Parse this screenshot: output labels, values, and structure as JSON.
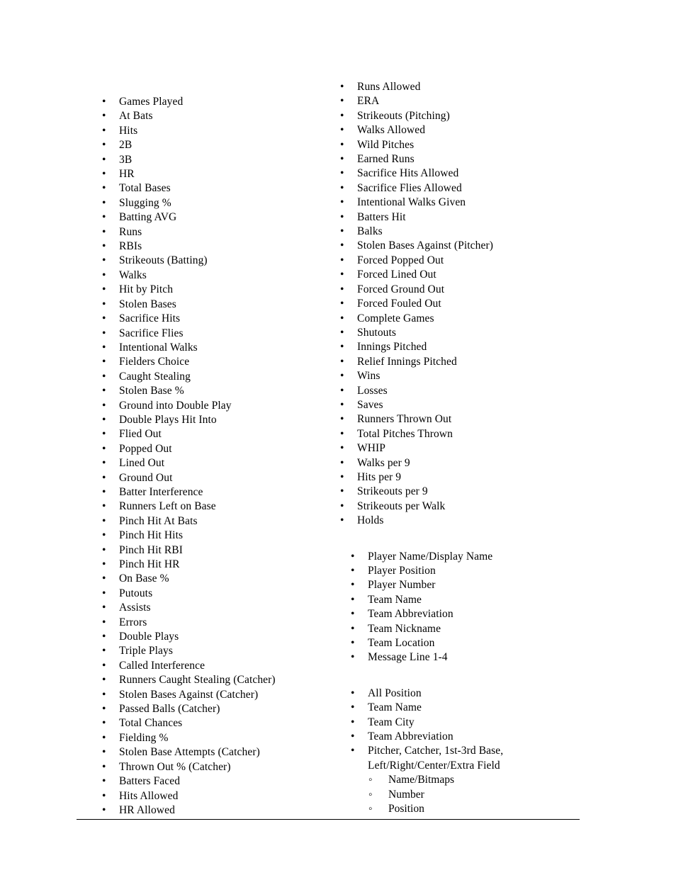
{
  "document": {
    "rule_color": "#000000"
  },
  "left_column": {
    "items": [
      "Games Played",
      "At Bats",
      "Hits",
      "2B",
      "3B",
      "HR",
      "Total Bases",
      "Slugging %",
      "Batting AVG",
      "Runs",
      "RBIs",
      "Strikeouts (Batting)",
      "Walks",
      "Hit by Pitch",
      "Stolen Bases",
      "Sacrifice Hits",
      "Sacrifice Flies",
      "Intentional Walks",
      "Fielders Choice",
      "Caught Stealing",
      "Stolen Base %",
      "Ground into Double Play",
      "Double Plays Hit Into",
      "Flied Out",
      "Popped Out",
      "Lined Out",
      "Ground Out",
      "Batter Interference",
      "Runners Left on Base",
      "Pinch Hit At Bats",
      "Pinch Hit Hits",
      "Pinch Hit RBI",
      "Pinch Hit HR",
      "On Base %",
      "Putouts",
      "Assists",
      "Errors",
      "Double Plays",
      "Triple Plays",
      "Called Interference",
      "Runners Caught Stealing (Catcher)",
      "Stolen Bases Against (Catcher)",
      "Passed Balls (Catcher)",
      "Total Chances",
      "Fielding %",
      "Stolen Base Attempts (Catcher)",
      "Thrown Out % (Catcher)",
      "Batters Faced",
      "Hits Allowed",
      "HR Allowed"
    ]
  },
  "right_column": {
    "group_pitching": {
      "items": [
        "Runs Allowed",
        "ERA",
        "Strikeouts (Pitching)",
        "Walks Allowed",
        "Wild Pitches",
        "Earned Runs",
        "Sacrifice Hits Allowed",
        "Sacrifice Flies Allowed",
        "Intentional Walks Given",
        "Batters Hit",
        "Balks",
        "Stolen Bases Against (Pitcher)",
        "Forced Popped Out",
        "Forced Lined Out",
        "Forced Ground Out",
        "Forced Fouled Out",
        "Complete Games",
        "Shutouts",
        "Innings Pitched",
        "Relief Innings Pitched",
        "Wins",
        "Losses",
        "Saves",
        "Runners Thrown Out",
        "Total Pitches Thrown",
        "WHIP",
        "Walks per 9",
        "Hits per 9",
        "Strikeouts per 9",
        "Strikeouts per Walk",
        "Holds"
      ]
    },
    "group_player_info": {
      "items": [
        "Player Name/Display Name",
        "Player Position",
        "Player Number",
        "Team Name",
        "Team Abbreviation",
        "Team Nickname",
        "Team Location",
        "Message Line 1-4"
      ]
    },
    "group_position_info": {
      "items": [
        "All Position",
        "Team Name",
        "Team City",
        "Team Abbreviation"
      ],
      "positions_item": "Pitcher, Catcher, 1st-3rd Base, Left/Right/Center/Extra Field",
      "position_sub_items": [
        "Name/Bitmaps",
        "Number",
        "Position"
      ]
    }
  }
}
